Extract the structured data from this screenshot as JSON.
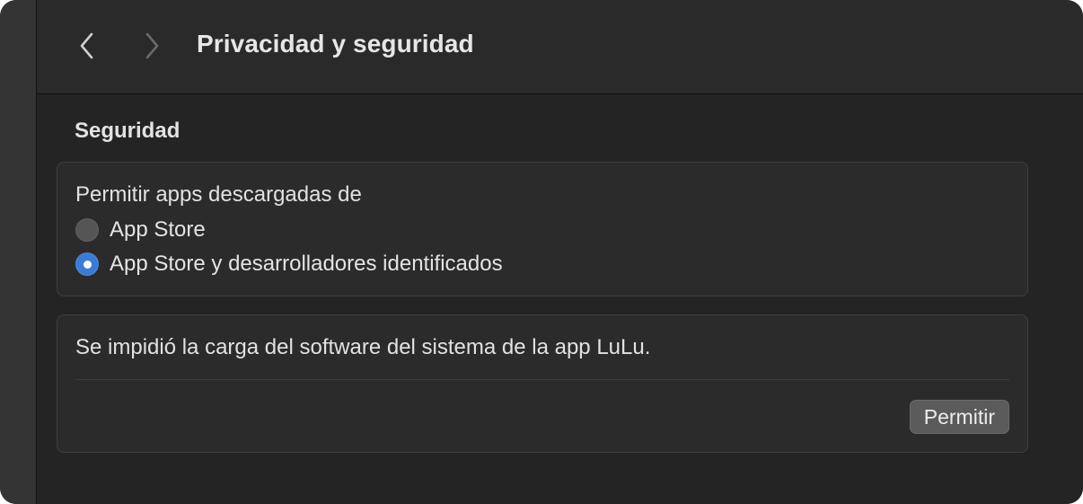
{
  "toolbar": {
    "title": "Privacidad y seguridad",
    "back_icon": "chevron-left-icon",
    "forward_icon": "chevron-right-icon"
  },
  "security": {
    "section_title": "Seguridad",
    "downloads": {
      "label": "Permitir apps descargadas de",
      "options": [
        {
          "label": "App Store",
          "selected": false
        },
        {
          "label": "App Store y desarrolladores identificados",
          "selected": true
        }
      ]
    },
    "blocked": {
      "message": "Se impidió la carga del software del sistema de la app LuLu.",
      "button_label": "Permitir"
    }
  },
  "colors": {
    "window_bg": "#242424",
    "group_bg": "#2b2b2b",
    "accent": "#3a7bd5",
    "text": "#e2e2e2"
  }
}
